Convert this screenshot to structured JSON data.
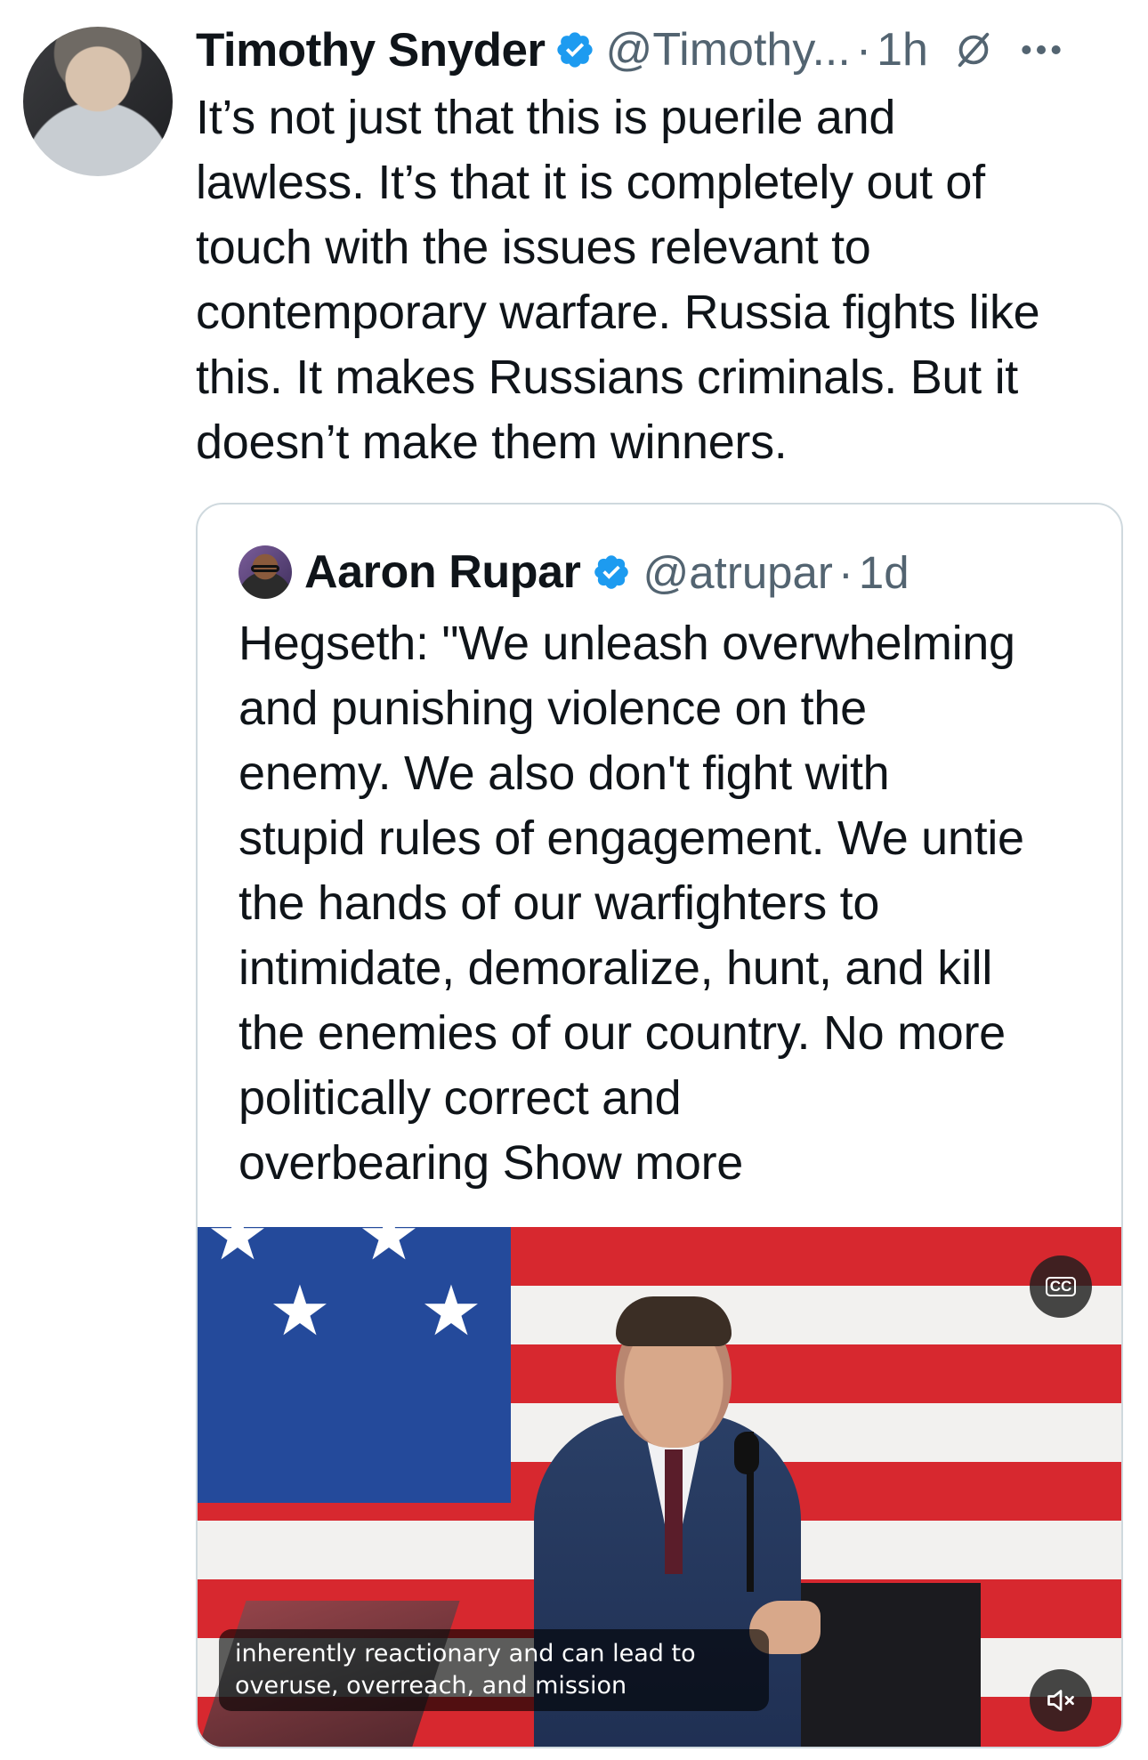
{
  "tweet": {
    "author_name": "Timothy Snyder",
    "handle": "@Timothy...",
    "separator": "·",
    "time": "1h",
    "text_lines": [
      "It’s not just that this is puerile and",
      "lawless. It’s that it is completely out of",
      "touch with the issues relevant to",
      "contemporary warfare. Russia fights like",
      "this. It makes Russians criminals. But it",
      "doesn’t make them winners."
    ]
  },
  "quoted": {
    "author_name": "Aaron Rupar",
    "handle": "@atrupar",
    "separator": "·",
    "time": "1d",
    "text_lines": [
      "Hegseth: \"We unleash overwhelming",
      "and punishing violence on the",
      "enemy. We also don't fight with",
      "stupid rules of engagement. We untie",
      "the hands of our warfighters to",
      "intimidate, demoralize, hunt, and kill",
      "the enemies of our country. No more",
      "politically correct and",
      "overbearing"
    ],
    "show_more": "Show more",
    "video": {
      "caption_line1": "inherently reactionary and can lead to",
      "caption_line2": "overuse, overreach, and mission",
      "cc_label": "CC"
    }
  },
  "colors": {
    "verified_blue": "#1d9bf0",
    "secondary_text": "#536471",
    "card_border": "#cfd9de"
  },
  "icons": {
    "verified": "verified-badge-icon",
    "grok": "grok-slash-icon",
    "more": "more-dots-icon",
    "cc": "closed-captions-icon",
    "mute": "muted-speaker-icon"
  }
}
